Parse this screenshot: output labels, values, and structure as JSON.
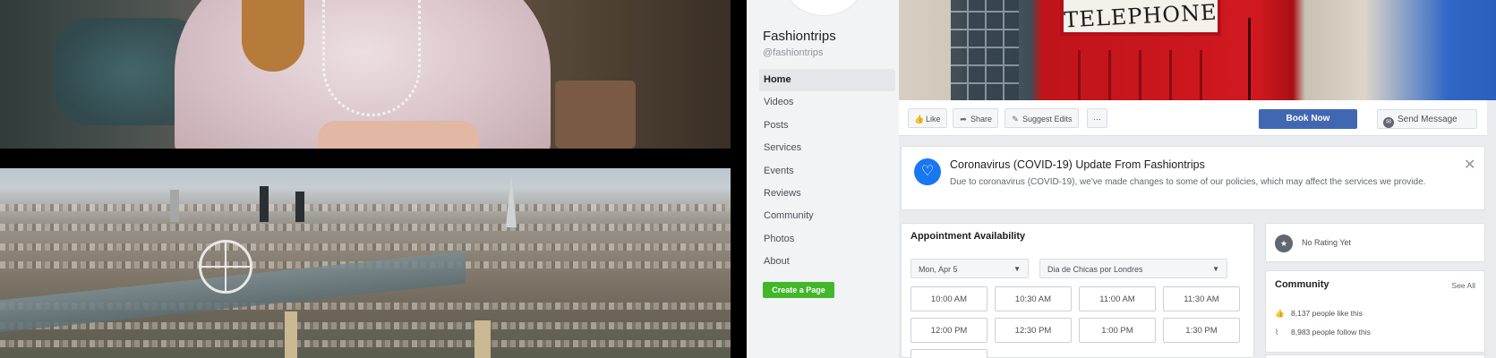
{
  "page": {
    "name": "Fashiontrips",
    "handle": "@fashiontrips"
  },
  "nav": {
    "items": [
      {
        "label": "Home",
        "active": true
      },
      {
        "label": "Videos"
      },
      {
        "label": "Posts"
      },
      {
        "label": "Services"
      },
      {
        "label": "Events"
      },
      {
        "label": "Reviews"
      },
      {
        "label": "Community"
      },
      {
        "label": "Photos"
      },
      {
        "label": "About"
      }
    ],
    "create_page": "Create a Page"
  },
  "cover": {
    "sign_text": "TELEPHONE"
  },
  "actions": {
    "like": "Like",
    "share": "Share",
    "suggest_edits": "Suggest Edits",
    "more": "···",
    "book_now": "Book Now",
    "send_message": "Send Message"
  },
  "covid": {
    "title": "Coronavirus (COVID-19) Update From Fashiontrips",
    "text": "Due to coronavirus (COVID-19), we've made changes to some of our policies, which may affect the services we provide.",
    "close": "✕"
  },
  "appointment": {
    "title": "Appointment Availability",
    "date": "Mon, Apr 5",
    "service": "Dia de Chicas por Londres",
    "slots": [
      "10:00 AM",
      "10:30 AM",
      "11:00 AM",
      "11:30 AM",
      "12:00 PM",
      "12:30 PM",
      "1:00 PM",
      "1:30 PM"
    ]
  },
  "rating": {
    "text": "No Rating Yet"
  },
  "community": {
    "title": "Community",
    "see_all": "See All",
    "likes": "8,137 people like this",
    "follows": "8,983 people follow this"
  },
  "colors": {
    "brand_blue": "#4267b2",
    "create_green": "#42b72a",
    "covid_blue": "#1877f2"
  }
}
